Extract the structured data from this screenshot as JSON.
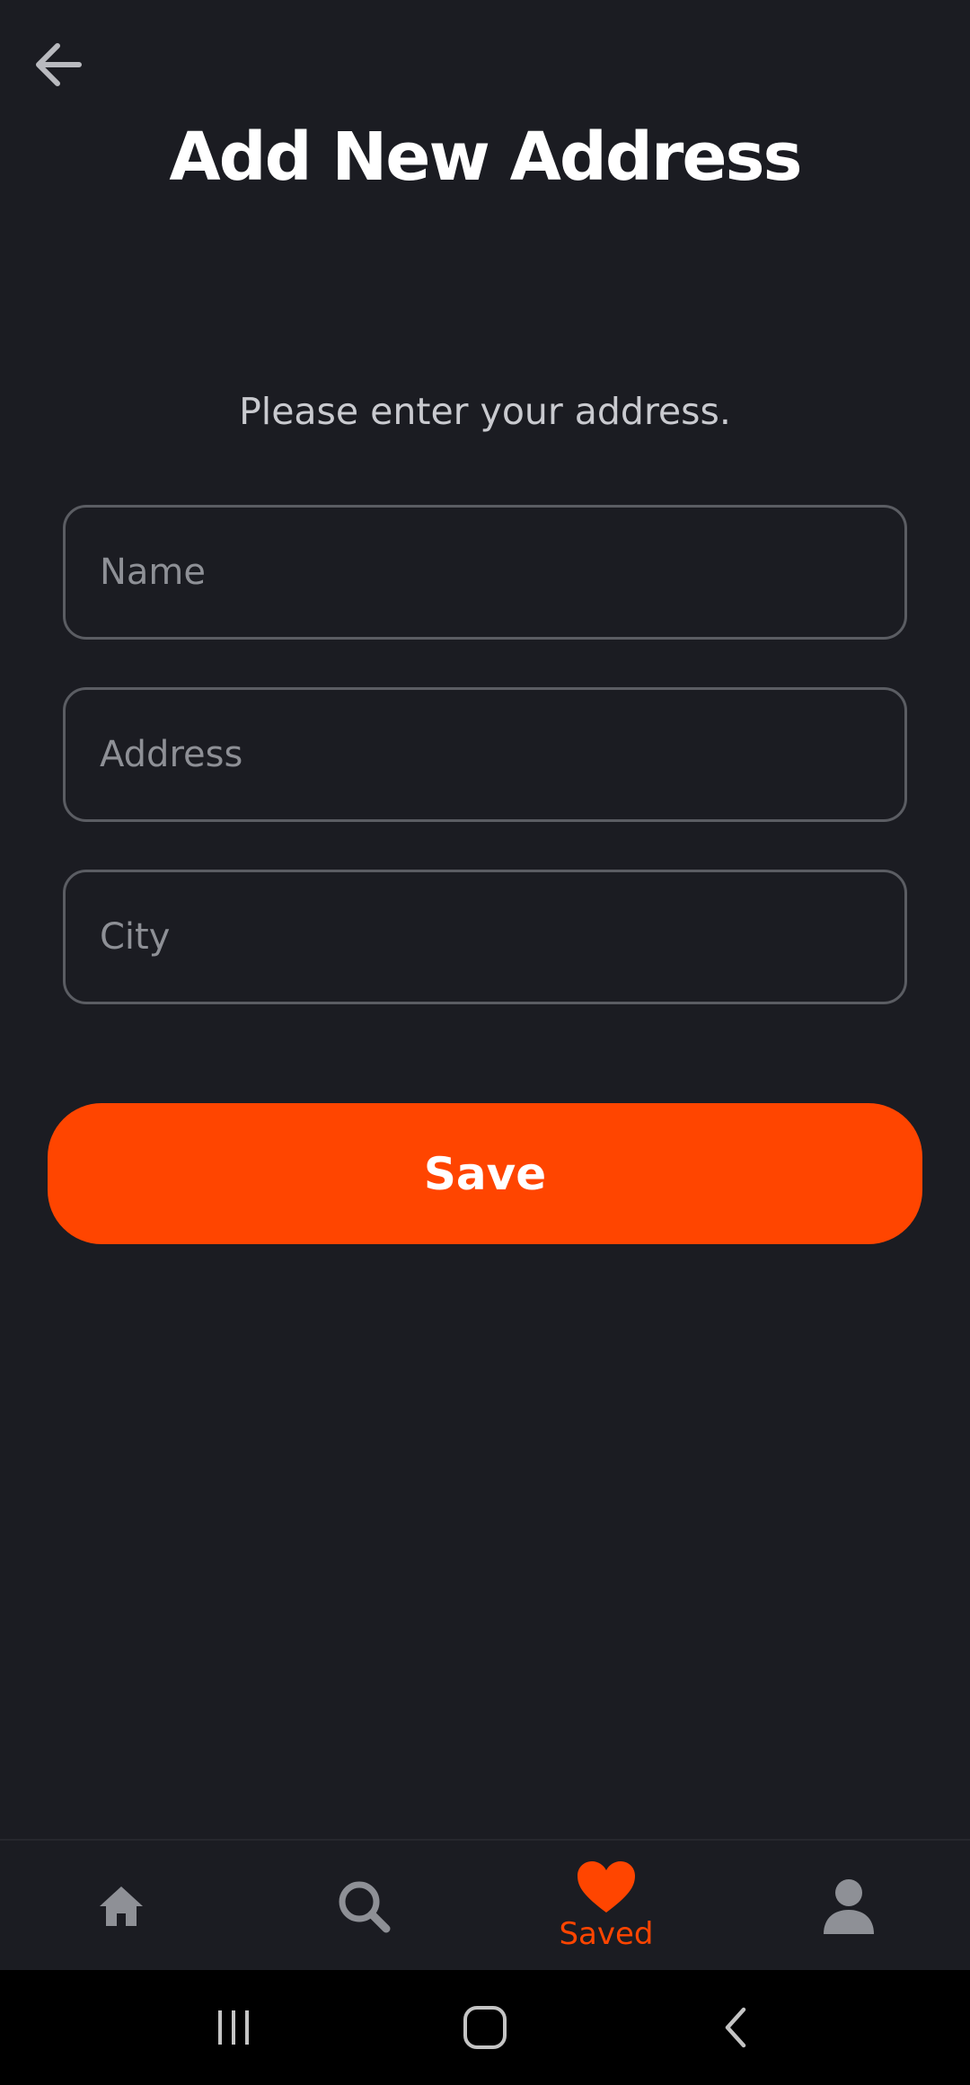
{
  "header": {
    "title": "Add New Address",
    "back_icon": "arrow-left-icon"
  },
  "form": {
    "prompt": "Please enter your address.",
    "name_placeholder": "Name",
    "address_placeholder": "Address",
    "city_placeholder": "City",
    "name_value": "",
    "address_value": "",
    "city_value": "",
    "save_label": "Save"
  },
  "bottom_nav": {
    "items": [
      {
        "icon": "home-icon",
        "label": "",
        "active": false
      },
      {
        "icon": "search-icon",
        "label": "",
        "active": false
      },
      {
        "icon": "heart-icon",
        "label": "Saved",
        "active": true
      },
      {
        "icon": "user-icon",
        "label": "",
        "active": false
      }
    ]
  },
  "colors": {
    "background": "#1b1c22",
    "accent": "#ff4500",
    "field_border": "#5b5d63",
    "inactive_icon": "#8e9096"
  }
}
